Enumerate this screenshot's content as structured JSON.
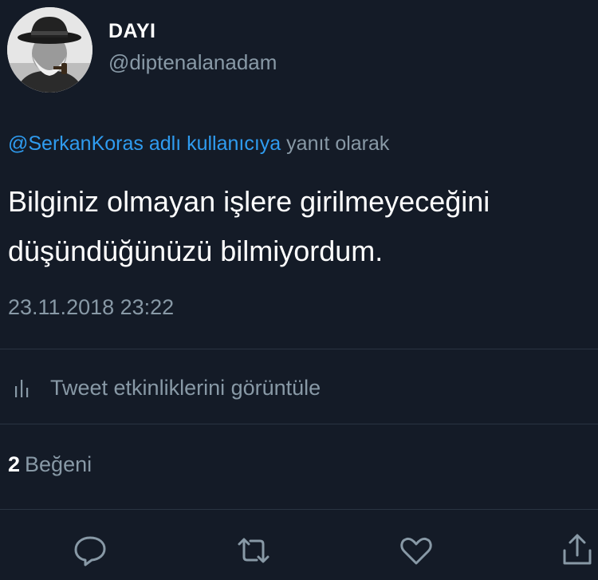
{
  "author": {
    "display_name": "DAYI",
    "handle": "@diptenalanadam"
  },
  "reply": {
    "link_text": "@SerkanKoras adlı kullanıcıya",
    "suffix": "yanıt olarak"
  },
  "tweet": {
    "text": "Bilginiz olmayan işlere girilmeyeceğini düşündüğünüzü bilmiyordum.",
    "timestamp": "23.11.2018 23:22"
  },
  "activity": {
    "label": "Tweet etkinliklerini görüntüle"
  },
  "likes": {
    "count": "2",
    "label": "Beğeni"
  },
  "actions": [
    "reply-icon",
    "retweet-icon",
    "like-icon",
    "share-icon"
  ],
  "colors": {
    "background": "#141b27",
    "link": "#2f9cf0",
    "secondary_text": "#8899a6",
    "divider": "#2a3442"
  }
}
